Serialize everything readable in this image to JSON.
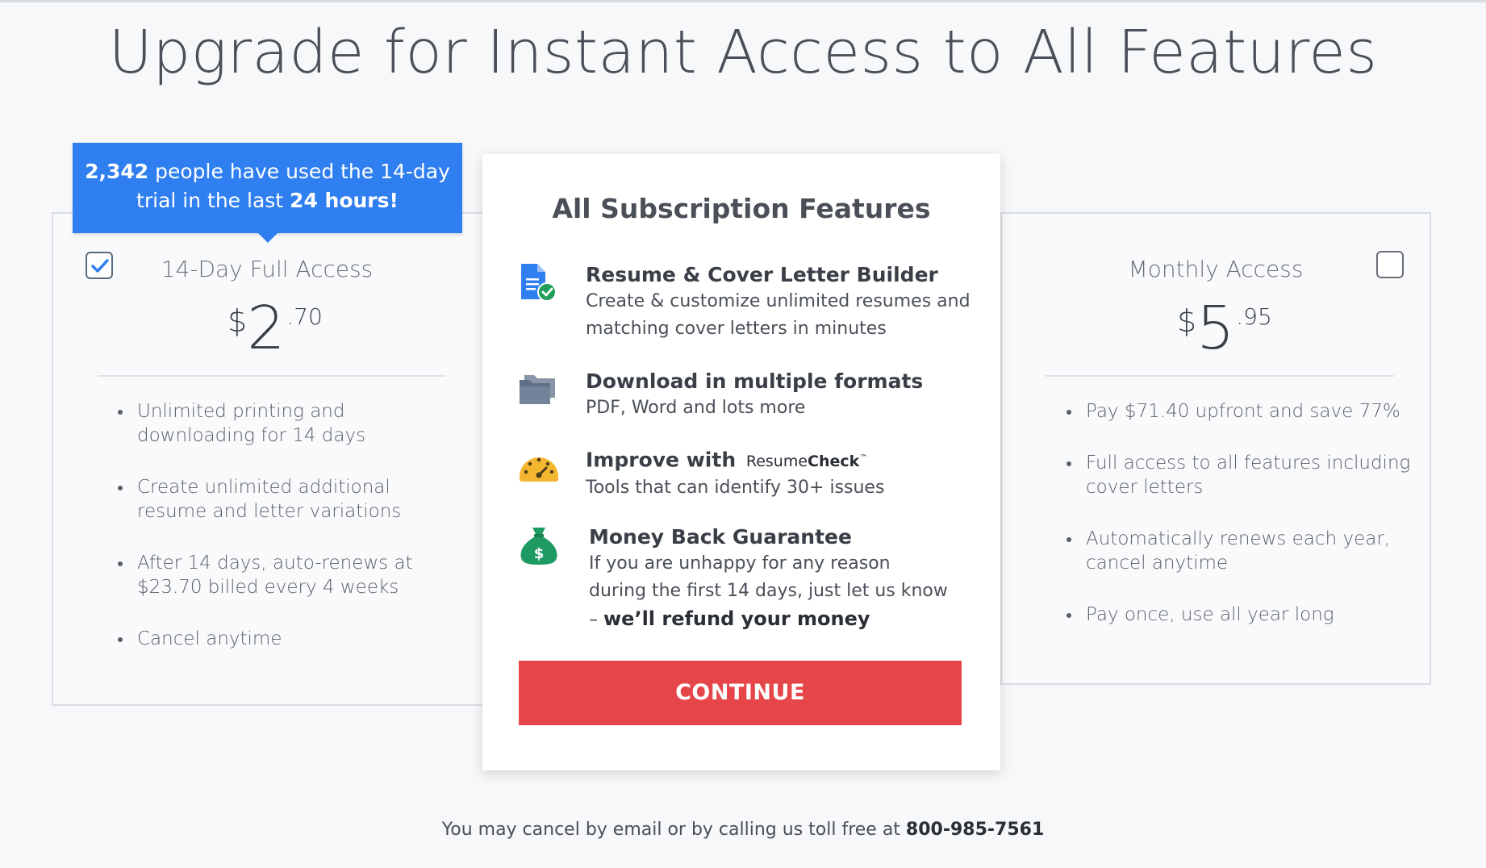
{
  "page": {
    "title": "Upgrade for Instant Access to All Features"
  },
  "badge": {
    "count": "2,342",
    "text_middle": " people have used the 14-day trial in the last ",
    "period": "24 hours!"
  },
  "plans": [
    {
      "name": "14-Day Full Access",
      "currency": "$",
      "price_main": "2",
      "price_cents": ".70",
      "selected": true,
      "bullets": [
        "Unlimited printing and downloading for 14 days",
        "Create unlimited additional resume and letter variations",
        "After 14 days, auto-renews at $23.70 billed every 4 weeks",
        "Cancel anytime"
      ]
    },
    {
      "name": "Monthly Access",
      "currency": "$",
      "price_main": "5",
      "price_cents": ".95",
      "selected": false,
      "bullets": [
        "Pay $71.40 upfront and save 77%",
        "Full access to all features including cover letters",
        "Automatically renews each year, cancel anytime",
        "Pay once, use all year long"
      ]
    }
  ],
  "features": {
    "heading": "All Subscription Features",
    "items": [
      {
        "icon": "document-check-icon",
        "title": "Resume & Cover Letter Builder",
        "desc": "Create & customize unlimited resumes and matching cover letters in minutes"
      },
      {
        "icon": "folder-icon",
        "title": "Download in multiple formats",
        "desc": "PDF, Word and lots more"
      },
      {
        "icon": "speedometer-icon",
        "title": "Improve with",
        "brand_regular": "Resume",
        "brand_bold": "Check",
        "brand_tm": "™",
        "desc": "Tools that can identify 30+ issues"
      },
      {
        "icon": "money-bag-icon",
        "title": "Money Back Guarantee",
        "desc": "If you are unhappy for any reason during the first 14 days, just let us know – ",
        "desc_bold": "we’ll refund your money"
      }
    ],
    "button_label": "CONTINUE"
  },
  "footer": {
    "text": "You may cancel by email or by calling us toll free at ",
    "phone": "800-985-7561"
  },
  "colors": {
    "badge": "#2f7ff0",
    "button": "#e6464a",
    "doc_icon": "#2f7ff0",
    "check_icon": "#21a05a",
    "gauge_icon": "#f3b62e",
    "bag_icon": "#1f9a63"
  }
}
